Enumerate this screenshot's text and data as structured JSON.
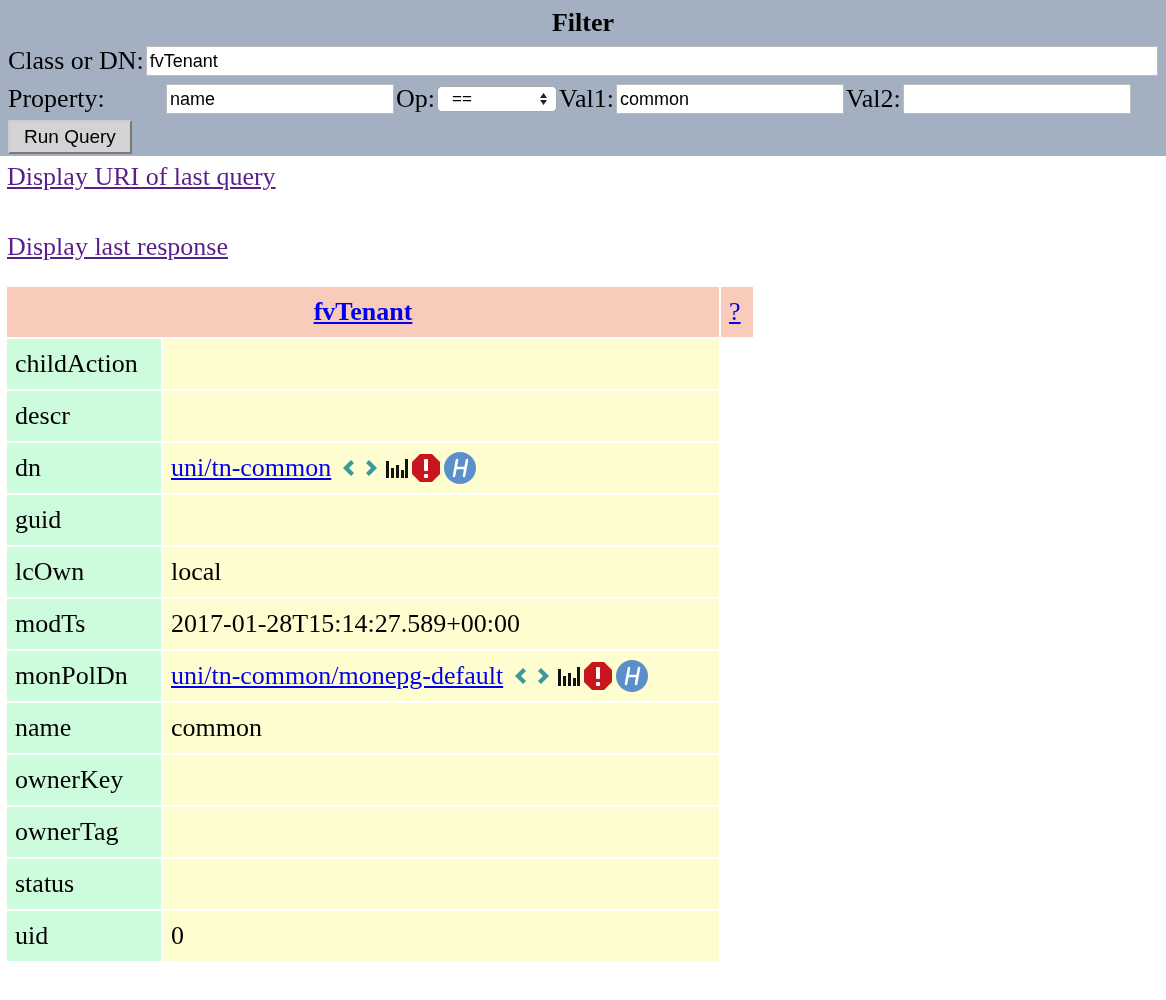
{
  "filter": {
    "title": "Filter",
    "class_label": "Class or DN:",
    "class_value": "fvTenant",
    "property_label": "Property:",
    "property_value": "name",
    "op_label": "Op:",
    "op_value": "==",
    "val1_label": "Val1:",
    "val1_value": "common",
    "val2_label": "Val2:",
    "button": "Run Query"
  },
  "links": [
    "Display URI of last query",
    "Display last response"
  ],
  "table": {
    "title": "fvTenant",
    "help": "?",
    "rows": [
      {
        "name": "childAction",
        "kind": "text"
      },
      {
        "name": "descr",
        "kind": "text"
      },
      {
        "name": "dn",
        "kind": "link",
        "value": "uni/tn-common"
      },
      {
        "name": "guid",
        "kind": "text"
      },
      {
        "name": "lcOwn",
        "kind": "text",
        "value": "local"
      },
      {
        "name": "modTs",
        "kind": "text",
        "value": "2017-01-28T15:14:27.589+00:00"
      },
      {
        "name": "monPolDn",
        "kind": "link",
        "value": "uni/tn-common/monepg-default"
      },
      {
        "name": "name",
        "kind": "text",
        "value": "common"
      },
      {
        "name": "ownerKey",
        "kind": "text"
      },
      {
        "name": "ownerTag",
        "kind": "text"
      },
      {
        "name": "status",
        "kind": "text"
      },
      {
        "name": "uid",
        "kind": "text",
        "value": "0"
      }
    ]
  }
}
